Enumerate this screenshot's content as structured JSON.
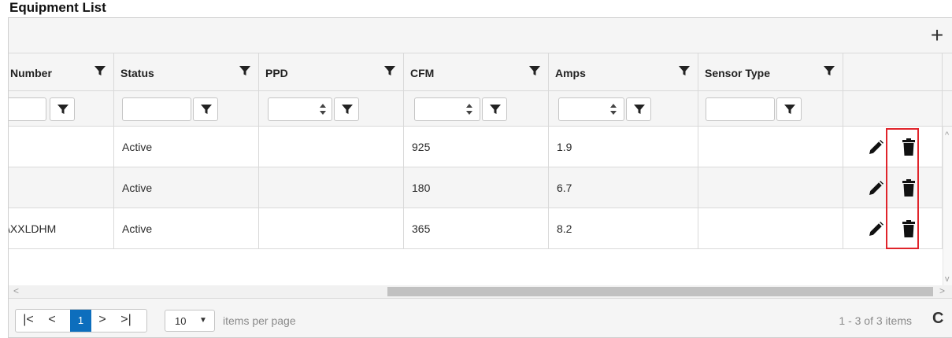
{
  "title": "Equipment List",
  "toolbar": {
    "add_label": "+"
  },
  "columns": [
    {
      "label": "Number"
    },
    {
      "label": "Status"
    },
    {
      "label": "PPD"
    },
    {
      "label": "CFM"
    },
    {
      "label": "Amps"
    },
    {
      "label": "Sensor Type"
    }
  ],
  "rows": [
    {
      "number": "",
      "status": "Active",
      "ppd": "",
      "cfm": "925",
      "amps": "1.9",
      "sensor_type": ""
    },
    {
      "number": "",
      "status": "Active",
      "ppd": "",
      "cfm": "180",
      "amps": "6.7",
      "sensor_type": ""
    },
    {
      "number": "\\XXLDHM",
      "status": "Active",
      "ppd": "",
      "cfm": "365",
      "amps": "8.2",
      "sensor_type": ""
    }
  ],
  "scroll": {
    "left_arrow": "<",
    "right_arrow": ">",
    "up_arrow": "^",
    "down_arrow": "v"
  },
  "pager": {
    "first": "|<",
    "prev": "<",
    "current_page": "1",
    "next": ">",
    "last": ">|",
    "page_size": "10",
    "page_size_caret": "▼",
    "items_per_page_label": "items per page",
    "info": "1 - 3 of 3 items",
    "refresh": "C"
  },
  "colors": {
    "accent": "#0d6ebd",
    "highlight": "#e0242b",
    "header_bg": "#f5f5f5"
  },
  "icons": [
    "filter-icon",
    "spinner-icon",
    "edit-icon",
    "delete-icon",
    "refresh-icon"
  ]
}
